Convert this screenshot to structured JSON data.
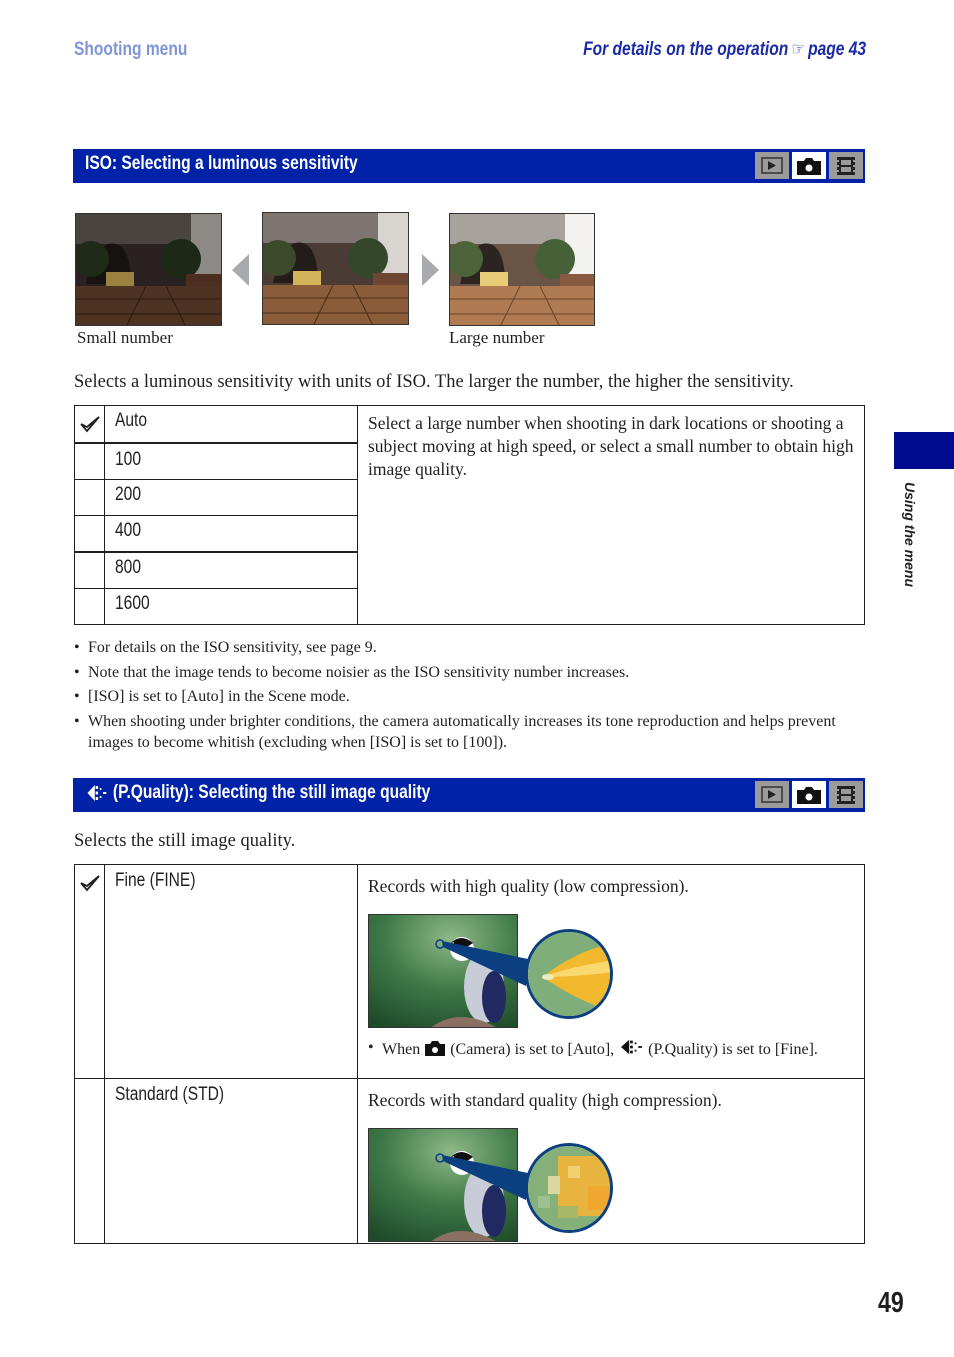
{
  "header": {
    "section": "Shooting menu",
    "reference_prefix": "For details on the operation",
    "reference_icon": "pointing-hand-icon",
    "reference_page": "page 43"
  },
  "iso_section": {
    "title": "ISO: Selecting a luminous sensitivity",
    "mode_icons": [
      {
        "name": "playback",
        "active": false
      },
      {
        "name": "camera",
        "active": true
      },
      {
        "name": "movie",
        "active": false
      }
    ],
    "photo_captions": {
      "left": "Small number",
      "right": "Large number"
    },
    "intro": "Selects a luminous sensitivity with units of ISO. The larger the number, the higher the sensitivity.",
    "options": [
      {
        "label": "Auto",
        "default": true
      },
      {
        "label": "100",
        "default": false
      },
      {
        "label": "200",
        "default": false
      },
      {
        "label": "400",
        "default": false
      },
      {
        "label": "800",
        "default": false
      },
      {
        "label": "1600",
        "default": false
      }
    ],
    "description": "Select a large number when shooting in dark locations or shooting a subject moving at high speed, or select a small number to obtain high image quality.",
    "notes": [
      "For details on the ISO sensitivity, see page 9.",
      "Note that the image tends to become noisier as the ISO sensitivity number increases.",
      "[ISO] is set to [Auto] in the Scene mode.",
      "When shooting under brighter conditions, the camera automatically increases its tone reproduction and helps prevent images to become whitish (excluding when [ISO] is set to [100])."
    ]
  },
  "quality_section": {
    "title": "(P.Quality): Selecting the still image quality",
    "title_icon": "picture-quality-icon",
    "mode_icons": [
      {
        "name": "playback",
        "active": false
      },
      {
        "name": "camera",
        "active": true
      },
      {
        "name": "movie",
        "active": false
      }
    ],
    "intro": "Selects the still image quality.",
    "options": [
      {
        "label": "Fine (FINE)",
        "default": true,
        "description": "Records with high quality (low compression).",
        "note_when": "When",
        "note_camera": "(Camera) is set to [Auto],",
        "note_pq": "(P.Quality) is set to [Fine]."
      },
      {
        "label": "Standard (STD)",
        "default": false,
        "description": "Records with standard quality (high compression)."
      }
    ]
  },
  "side_tab": {
    "label": "Using the menu"
  },
  "page_number": "49",
  "colors": {
    "section_bar": "#0022a8",
    "header_left": "#7f95d6",
    "header_right": "#1a2aa6",
    "side_tab": "#000c8f",
    "mode_inactive": "#9b9b9b"
  }
}
